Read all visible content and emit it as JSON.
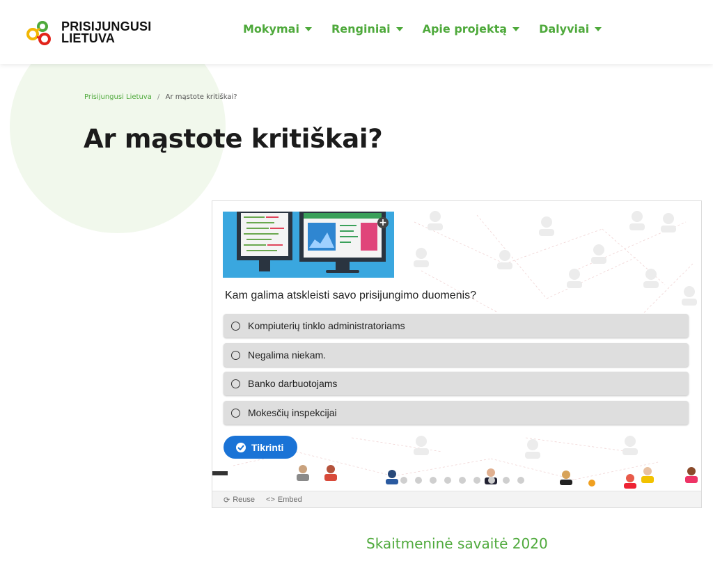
{
  "header": {
    "logo": {
      "line1": "PRISIJUNGUSI",
      "line2": "LIETUVA"
    },
    "nav": [
      {
        "label": "Mokymai"
      },
      {
        "label": "Renginiai"
      },
      {
        "label": "Apie projektą"
      },
      {
        "label": "Dalyviai"
      }
    ]
  },
  "breadcrumb": {
    "home": "Prisijungusi Lietuva",
    "separator": "/",
    "current": "Ar mąstote kritiškai?"
  },
  "page_title": "Ar mąstote kritiškai?",
  "quiz": {
    "question": "Kam galima atskleisti savo prisijungimo duomenis?",
    "options": [
      {
        "label": "Kompiuterių tinklo administratoriams"
      },
      {
        "label": "Negalima niekam."
      },
      {
        "label": "Banko darbuotojams"
      },
      {
        "label": "Mokesčių inspekcijai"
      }
    ],
    "check_button": "Tikrinti",
    "footer": {
      "reuse": "Reuse",
      "embed": "Embed"
    }
  },
  "section_title": "Skaitmeninė savaitė 2020",
  "colors": {
    "brand_green": "#4ea93b",
    "button_blue": "#1a73d6",
    "option_bg": "#dedede"
  },
  "icons": [
    "logo-mark",
    "caret-down-icon",
    "zoom-plus-icon",
    "radio-icon",
    "check-circle-icon",
    "reuse-icon",
    "embed-icon"
  ]
}
